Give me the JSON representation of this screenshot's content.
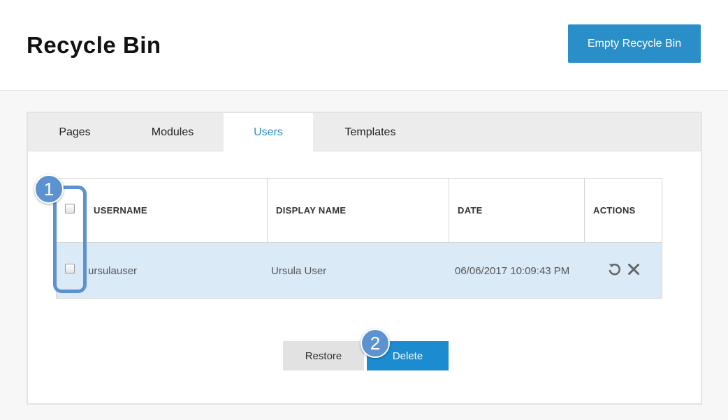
{
  "header": {
    "title": "Recycle Bin",
    "empty_button_label": "Empty Recycle Bin"
  },
  "tabs": [
    {
      "label": "Pages",
      "active": false
    },
    {
      "label": "Modules",
      "active": false
    },
    {
      "label": "Users",
      "active": true
    },
    {
      "label": "Templates",
      "active": false
    }
  ],
  "table": {
    "columns": [
      "USERNAME",
      "DISPLAY NAME",
      "DATE",
      "ACTIONS"
    ],
    "rows": [
      {
        "username": "ursulauser",
        "display_name": "Ursula User",
        "date": "06/06/2017 10:09:43 PM",
        "actions": [
          "restore-icon",
          "delete-icon"
        ],
        "checked": false
      }
    ],
    "select_all_checked": false
  },
  "footer": {
    "restore_label": "Restore",
    "delete_label": "Delete"
  },
  "callouts": [
    "1",
    "2"
  ],
  "colors": {
    "accent": "#2a8fc9",
    "callout": "#5b92cf",
    "row_highlight": "#dbeaf7"
  }
}
